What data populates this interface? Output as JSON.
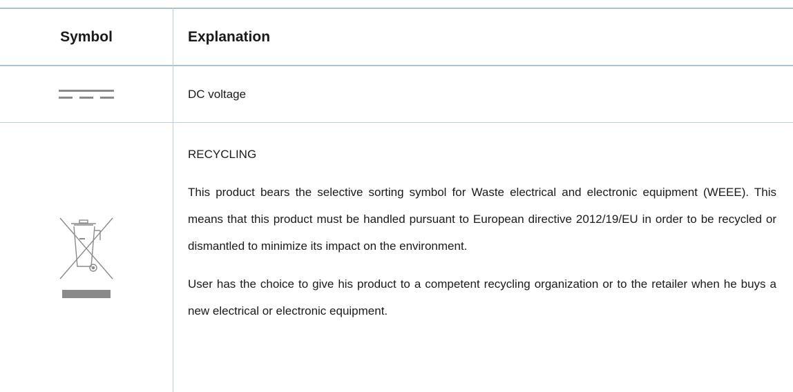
{
  "table": {
    "header": {
      "symbol": "Symbol",
      "explanation": "Explanation"
    },
    "rows": [
      {
        "symbol_icon": "dc-voltage-icon",
        "explanation": "DC voltage"
      },
      {
        "symbol_icon": "weee-crossed-bin-icon",
        "heading": "RECYCLING",
        "paragraph1": "This product bears the selective sorting symbol for Waste electrical and electronic equipment (WEEE). This means that this product must be handled pursuant to European directive 2012/19/EU in order to be recycled or dismantled to minimize its impact on the environment.",
        "paragraph2": "User has the choice to give his product to a competent recycling organization or to the retailer when he buys a new electrical or electronic equipment."
      }
    ]
  },
  "colors": {
    "rule": "#a8c2dc",
    "text": "#1a1a1a",
    "icon": "#8a8a8a"
  }
}
